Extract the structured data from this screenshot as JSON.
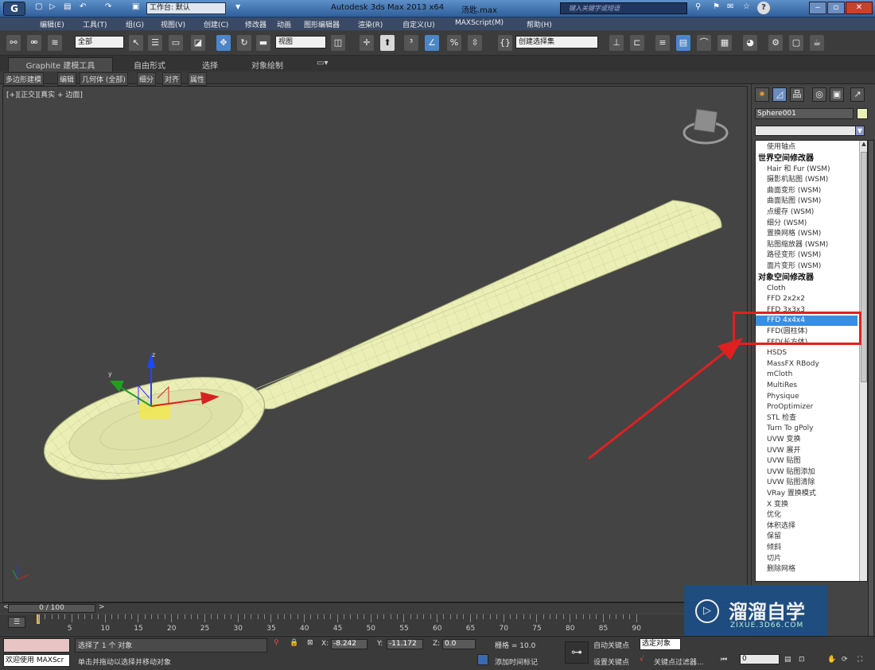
{
  "titlebar": {
    "workspace": "工作台: 默认",
    "app_title": "Autodesk 3ds Max  2013 x64",
    "filename": "汤匙.max",
    "search_placeholder": "键入关键字或短语"
  },
  "menubar": {
    "items": [
      "编辑(E)",
      "工具(T)",
      "组(G)",
      "视图(V)",
      "创建(C)",
      "修改器",
      "动画",
      "图形编辑器",
      "渲染(R)",
      "自定义(U)",
      "MAXScript(M)",
      "帮助(H)"
    ]
  },
  "toolbar": {
    "filter_value": "全部",
    "refcoord_value": "视图",
    "selection_set_value": "创建选择集"
  },
  "ribbon": {
    "tabs": [
      "Graphite 建模工具",
      "自由形式",
      "选择",
      "对象绘制"
    ]
  },
  "subribbon": {
    "items": [
      "多边形建模",
      "编辑",
      "几何体 (全部)",
      "细分",
      "对齐",
      "属性"
    ]
  },
  "viewport": {
    "label": "[+][正交][真实 + 边面]"
  },
  "cmdpanel": {
    "object_name": "Sphere001",
    "modifiers": [
      {
        "type": "item",
        "label": "使用轴点"
      },
      {
        "type": "header",
        "label": "世界空间修改器"
      },
      {
        "type": "item",
        "label": "Hair 和 Fur (WSM)"
      },
      {
        "type": "item",
        "label": "摄影机贴图 (WSM)"
      },
      {
        "type": "item",
        "label": "曲面变形 (WSM)"
      },
      {
        "type": "item",
        "label": "曲面贴图 (WSM)"
      },
      {
        "type": "item",
        "label": "点缓存 (WSM)"
      },
      {
        "type": "item",
        "label": "细分 (WSM)"
      },
      {
        "type": "item",
        "label": "置换网格 (WSM)"
      },
      {
        "type": "item",
        "label": "贴图缩放器 (WSM)"
      },
      {
        "type": "item",
        "label": "路径变形 (WSM)"
      },
      {
        "type": "item",
        "label": "面片变形 (WSM)"
      },
      {
        "type": "header",
        "label": "对象空间修改器"
      },
      {
        "type": "item",
        "label": "Cloth"
      },
      {
        "type": "item",
        "label": "FFD 2x2x2"
      },
      {
        "type": "item",
        "label": "FFD 3x3x3"
      },
      {
        "type": "selected",
        "label": "FFD 4x4x4"
      },
      {
        "type": "item",
        "label": "FFD(圆柱体)"
      },
      {
        "type": "item",
        "label": "FFD(长方体)"
      },
      {
        "type": "item",
        "label": "HSDS"
      },
      {
        "type": "item",
        "label": "MassFX RBody"
      },
      {
        "type": "item",
        "label": "mCloth"
      },
      {
        "type": "item",
        "label": "MultiRes"
      },
      {
        "type": "item",
        "label": "Physique"
      },
      {
        "type": "item",
        "label": "ProOptimizer"
      },
      {
        "type": "item",
        "label": "STL 检查"
      },
      {
        "type": "item",
        "label": "Turn To gPoly"
      },
      {
        "type": "item",
        "label": "UVW 变换"
      },
      {
        "type": "item",
        "label": "UVW 展开"
      },
      {
        "type": "item",
        "label": "UVW 贴图"
      },
      {
        "type": "item",
        "label": "UVW 贴图添加"
      },
      {
        "type": "item",
        "label": "UVW 贴图清除"
      },
      {
        "type": "item",
        "label": "VRay 置换模式"
      },
      {
        "type": "item",
        "label": "X 变换"
      },
      {
        "type": "item",
        "label": "优化"
      },
      {
        "type": "item",
        "label": "体积选择"
      },
      {
        "type": "item",
        "label": "保留"
      },
      {
        "type": "item",
        "label": "倾斜"
      },
      {
        "type": "item",
        "label": "切片"
      },
      {
        "type": "item",
        "label": "删除网格"
      }
    ]
  },
  "timeline": {
    "frame": "0 / 100",
    "ticks": [
      "5",
      "10",
      "15",
      "20",
      "25",
      "30",
      "35",
      "40",
      "45",
      "50",
      "55",
      "60",
      "65",
      "70",
      "75",
      "80",
      "85",
      "90"
    ]
  },
  "status": {
    "maxscript": "欢迎使用 MAXScr",
    "selected": "选择了 1 个 对象",
    "prompt": "单击并拖动以选择并移动对象",
    "x_label": "X:",
    "x_value": "-8.242",
    "y_label": "Y:",
    "y_value": "-11.172",
    "z_label": "Z:",
    "z_value": "0.0",
    "grid": "栅格 = 10.0",
    "autokey": "自动关键点",
    "selected_set": "选定对象",
    "setkey": "设置关键点",
    "keyfilter": "关键点过滤器...",
    "add_time_tag": "添加时间标记",
    "frame_value": "0"
  },
  "watermark": {
    "text": "溜溜自学",
    "url": "ZIXUE.3D66.COM"
  },
  "colors": {
    "spoon": "#ecefb5",
    "highlight": "#e02020",
    "selection": "#3a8de0"
  }
}
